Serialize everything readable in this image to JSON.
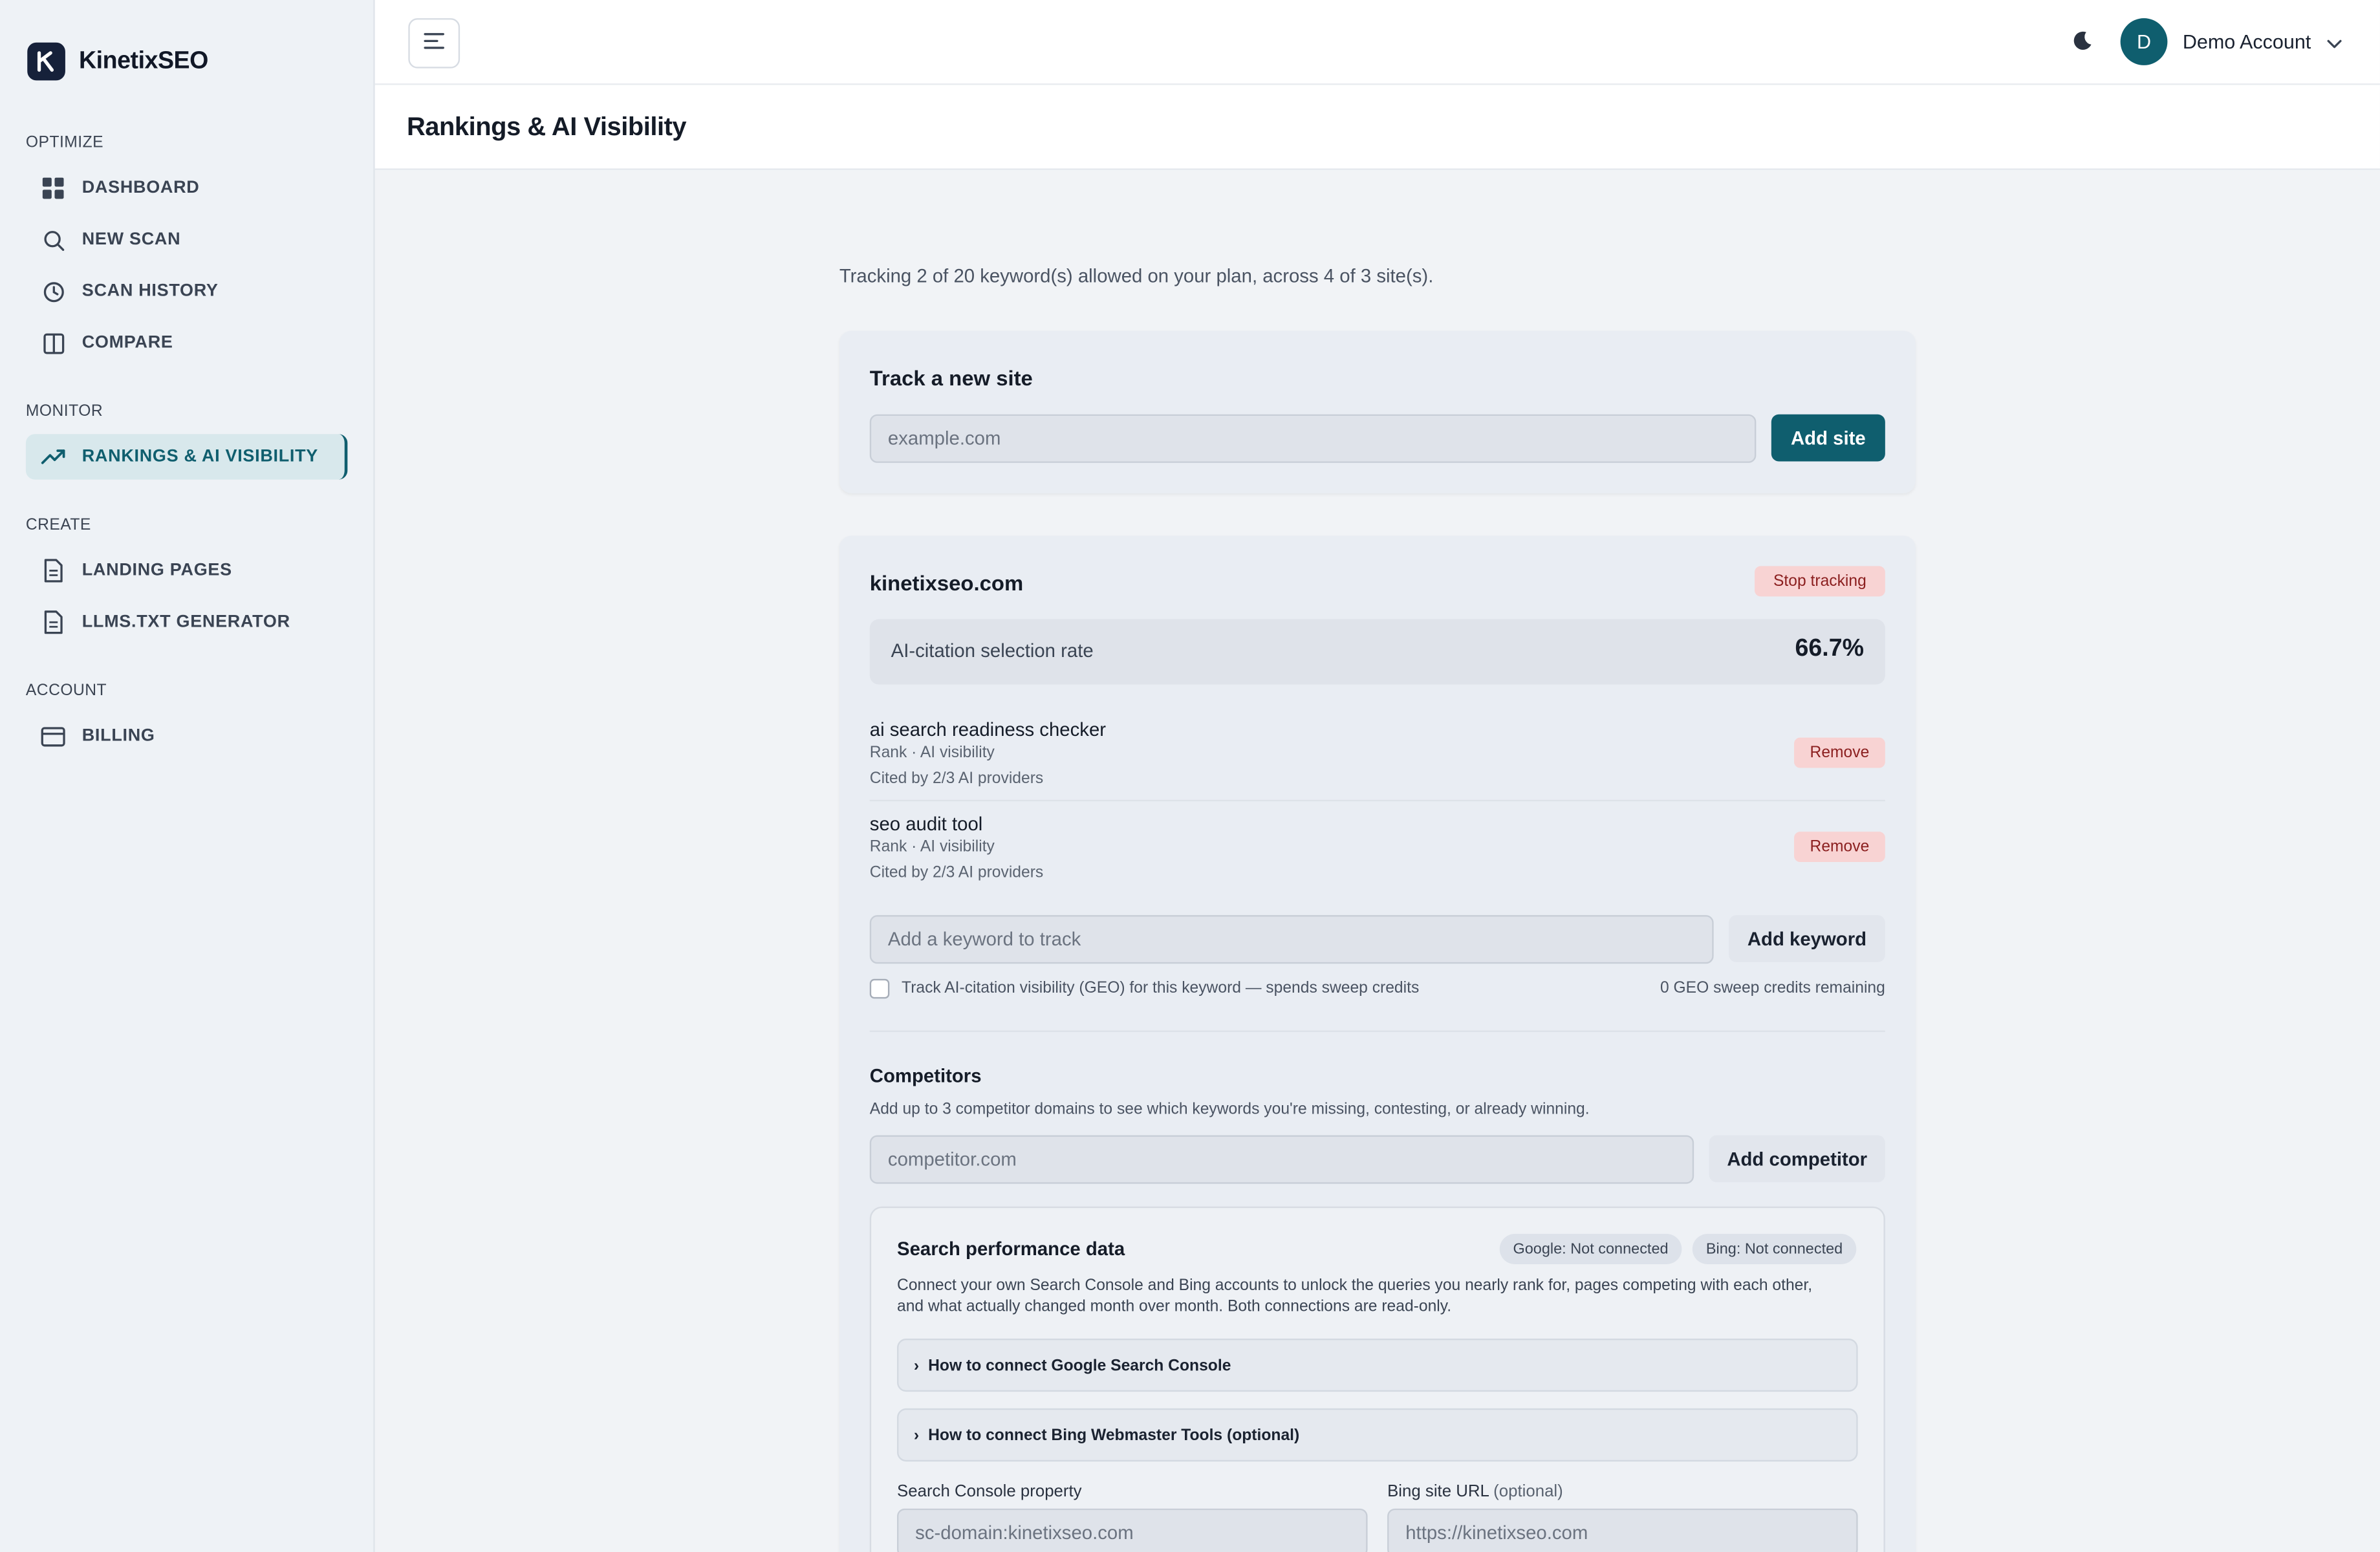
{
  "brand": {
    "name": "KinetixSEO"
  },
  "sidebar": {
    "sections": [
      {
        "title": "OPTIMIZE"
      },
      {
        "title": "MONITOR"
      },
      {
        "title": "CREATE"
      },
      {
        "title": "ACCOUNT"
      }
    ],
    "items": [
      {
        "label": "DASHBOARD",
        "icon": "grid-icon"
      },
      {
        "label": "NEW SCAN",
        "icon": "search-icon"
      },
      {
        "label": "SCAN HISTORY",
        "icon": "clock-icon"
      },
      {
        "label": "COMPARE",
        "icon": "columns-icon"
      },
      {
        "label": "RANKINGS & AI VISIBILITY",
        "icon": "trending-up-icon",
        "active": true
      },
      {
        "label": "LANDING PAGES",
        "icon": "document-icon"
      },
      {
        "label": "LLMS.TXT GENERATOR",
        "icon": "document-icon"
      },
      {
        "label": "BILLING",
        "icon": "credit-card-icon"
      }
    ]
  },
  "topbar": {
    "avatar_initial": "D",
    "account_name": "Demo Account"
  },
  "page": {
    "title": "Rankings & AI Visibility"
  },
  "tracking_note": "Tracking 2 of 20 keyword(s) allowed on your plan, across 4 of 3 site(s).",
  "new_site": {
    "title": "Track a new site",
    "placeholder": "example.com",
    "button": "Add site"
  },
  "site": {
    "domain": "kinetixseo.com",
    "stop_button": "Stop tracking",
    "metric_label": "AI-citation selection rate",
    "metric_value": "66.7%",
    "keywords": [
      {
        "name": "ai search readiness checker",
        "sub": "Rank · AI visibility",
        "cited": "Cited by 2/3 AI providers",
        "remove": "Remove"
      },
      {
        "name": "seo audit tool",
        "sub": "Rank · AI visibility",
        "cited": "Cited by 2/3 AI providers",
        "remove": "Remove"
      }
    ],
    "keyword_placeholder": "Add a keyword to track",
    "add_keyword_button": "Add keyword",
    "geo_checkbox_label": "Track AI-citation visibility (GEO) for this keyword — spends sweep credits",
    "geo_credits": "0 GEO sweep credits remaining",
    "competitors": {
      "title": "Competitors",
      "description": "Add up to 3 competitor domains to see which keywords you're missing, contesting, or already winning.",
      "placeholder": "competitor.com",
      "button": "Add competitor"
    },
    "search_perf": {
      "title": "Search performance data",
      "google_pill": "Google: Not connected",
      "bing_pill": "Bing: Not connected",
      "description_line1": "Connect your own Search Console and Bing accounts to unlock the queries you nearly rank for, pages competing with each other,",
      "description_line2": "and what actually changed month over month. Both connections are read-only.",
      "accordion_google": "How to connect Google Search Console",
      "accordion_bing": "How to connect Bing Webmaster Tools (optional)",
      "sc_label": "Search Console property",
      "sc_value": "sc-domain:kinetixseo.com",
      "bing_label": "Bing site URL",
      "bing_label_optional": "(optional)",
      "bing_value": "https://kinetixseo.com"
    }
  },
  "colors": {
    "accent": "#0f5e6e",
    "danger_bg": "#f8d3d3",
    "sidebar_bg": "#eef2f6"
  }
}
